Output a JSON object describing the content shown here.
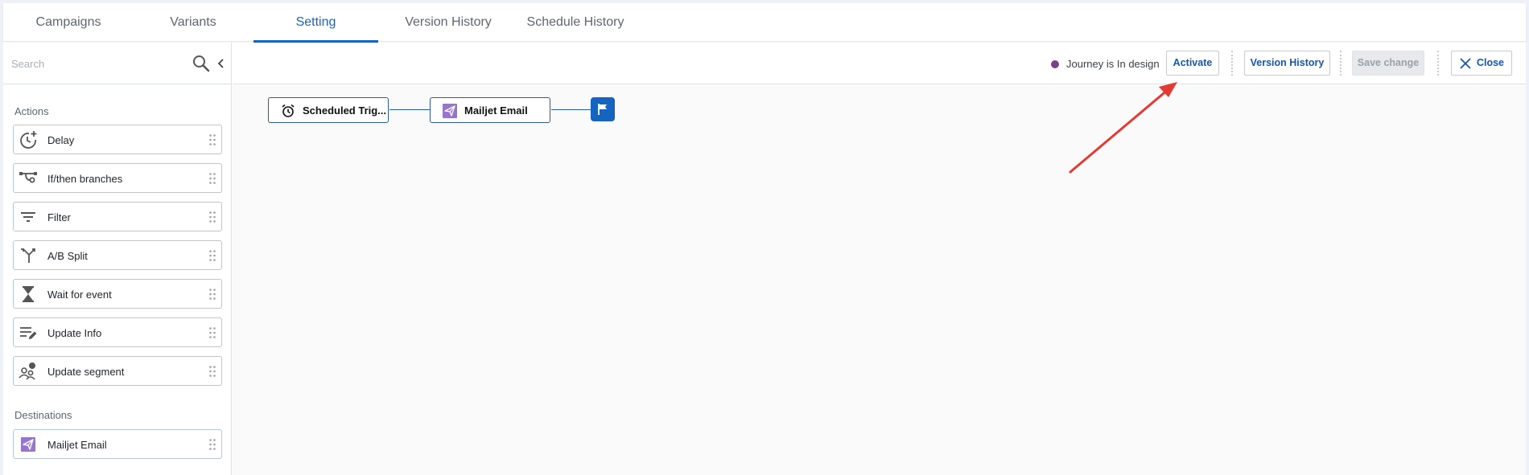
{
  "tabs": [
    {
      "label": "Campaigns"
    },
    {
      "label": "Variants"
    },
    {
      "label": "Setting"
    },
    {
      "label": "Version History"
    },
    {
      "label": "Schedule History"
    }
  ],
  "active_tab": "Setting",
  "sidebar": {
    "search_placeholder": "Search",
    "actions_heading": "Actions",
    "actions": [
      {
        "label": "Delay",
        "icon": "delay-icon"
      },
      {
        "label": "If/then branches",
        "icon": "branch-icon"
      },
      {
        "label": "Filter",
        "icon": "filter-icon"
      },
      {
        "label": "A/B Split",
        "icon": "split-icon"
      },
      {
        "label": "Wait for event",
        "icon": "hourglass-icon"
      },
      {
        "label": "Update Info",
        "icon": "edit-list-icon"
      },
      {
        "label": "Update segment",
        "icon": "segment-icon"
      }
    ],
    "destinations_heading": "Destinations",
    "destinations": [
      {
        "label": "Mailjet Email",
        "icon": "mailjet-icon"
      }
    ]
  },
  "toolbar": {
    "status_text": "Journey is In design",
    "status_color": "#7b3f8c",
    "activate_label": "Activate",
    "version_history_label": "Version History",
    "save_label": "Save change",
    "close_label": "Close"
  },
  "canvas": {
    "nodes": [
      {
        "label": "Scheduled Trig...",
        "icon": "alarm-clock-icon"
      },
      {
        "label": "Mailjet Email",
        "icon": "mailjet-icon"
      }
    ],
    "end_icon": "flag-icon"
  },
  "colors": {
    "accent": "#1565c0",
    "annotation_arrow": "#e53935",
    "mailjet": "#9575cd"
  }
}
